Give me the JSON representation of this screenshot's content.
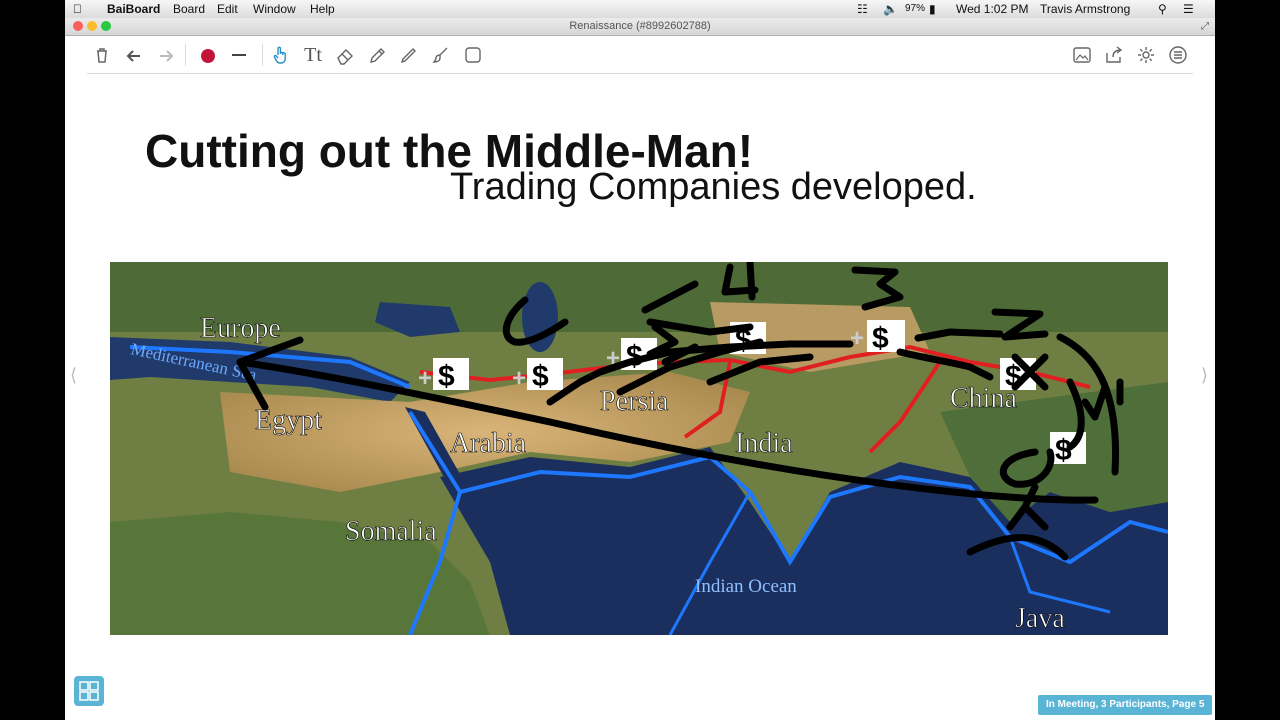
{
  "menubar": {
    "app_name": "BaiBoard",
    "menus": [
      "Board",
      "Edit",
      "Window",
      "Help"
    ],
    "battery": "97%",
    "clock": "Wed 1:02 PM",
    "user": "Travis Armstrong"
  },
  "window": {
    "title": "Renaissance (#8992602788)"
  },
  "toolbar": {
    "left_tools": [
      "trash-icon",
      "undo-icon",
      "redo-icon",
      "color-dot-icon",
      "line-width-icon",
      "hand-pointer-icon",
      "text-tool-icon",
      "eraser-icon",
      "marker-icon",
      "pencil-icon",
      "brush-icon",
      "shape-icon"
    ],
    "right_tools": [
      "image-icon",
      "share-icon",
      "settings-icon",
      "menu-icon"
    ],
    "text_tool_label": "Tt",
    "pen_color": "#c0143c"
  },
  "slide": {
    "title": "Cutting out the Middle-Man!",
    "subtitle": "Trading Companies developed.",
    "map_labels": {
      "europe": "Europe",
      "sea": "Mediterranean Sea",
      "egypt": "Egypt",
      "arabia": "Arabia",
      "persia": "Persia",
      "india": "India",
      "china": "China",
      "somalia": "Somalia",
      "ocean": "Indian Ocean",
      "java": "Java"
    },
    "dollar_badge": "$",
    "plus_sign": "+",
    "handwritten_numbers": [
      "6",
      "5",
      "4",
      "3",
      "2",
      "1"
    ]
  },
  "status_text": "In Meeting, 3 Participants, Page 5",
  "colors": {
    "accent": "#5ab4d6",
    "route_land": "#e02020",
    "route_sea": "#1e78ff"
  }
}
